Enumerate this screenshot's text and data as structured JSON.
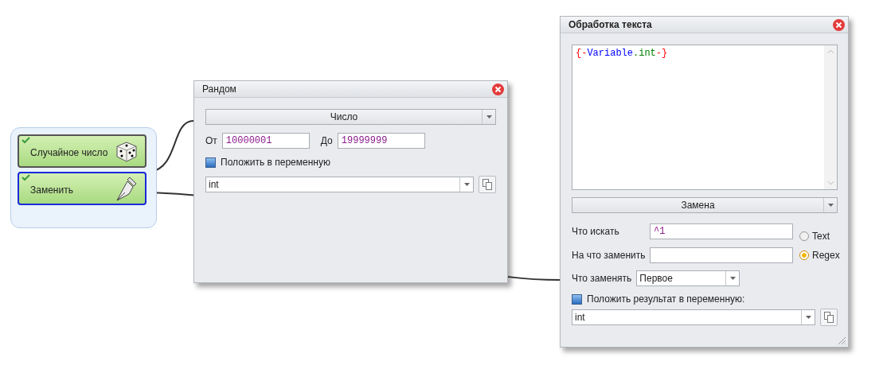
{
  "nodes": [
    {
      "label": "Случайное число",
      "kind": "dice",
      "enabled": true,
      "selected": false
    },
    {
      "label": "Заменить",
      "kind": "pen",
      "enabled": true,
      "selected": true
    }
  ],
  "random_window": {
    "title": "Рандом",
    "mode": "Число",
    "from_label": "От",
    "from_value": "10000001",
    "to_label": "До",
    "to_value": "19999999",
    "save_label": "Положить в переменную",
    "variable": "int"
  },
  "text_window": {
    "title": "Обработка текста",
    "code_tokens": [
      {
        "text": "{-",
        "color": "#ff0000"
      },
      {
        "text": "Variable",
        "color": "#0000ff"
      },
      {
        "text": ".int",
        "color": "#008000"
      },
      {
        "text": "-}",
        "color": "#ff0000"
      }
    ],
    "action": "Замена",
    "find_label": "Что искать",
    "find_value": "^1",
    "replace_label": "На что заменить",
    "modes": [
      {
        "label": "Text",
        "selected": false
      },
      {
        "label": "Regex",
        "selected": true
      }
    ],
    "which_label": "Что заменять",
    "which_value": "Первое",
    "save_label": "Положить результат в переменную:",
    "variable": "int"
  }
}
